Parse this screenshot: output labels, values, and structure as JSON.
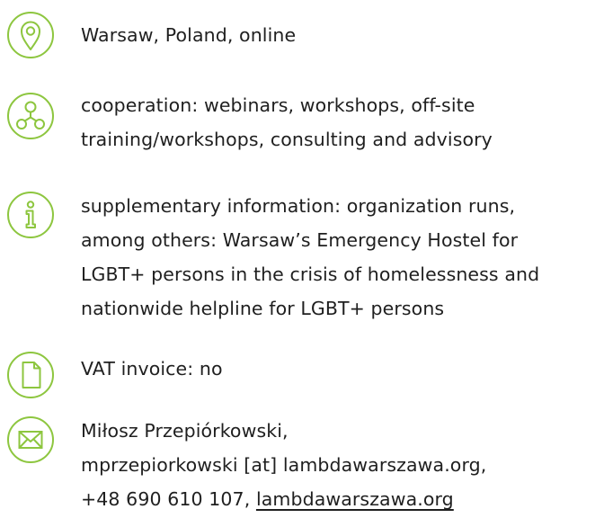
{
  "accent_color": "#8dc63f",
  "text_color": "#1f1f1f",
  "items": [
    {
      "icon": "location-pin-icon",
      "lines": [
        "Warsaw, Poland, online"
      ]
    },
    {
      "icon": "network-nodes-icon",
      "lines": [
        "cooperation: webinars, workshops, off-site",
        "training/workshops, consulting and advisory"
      ]
    },
    {
      "icon": "info-icon",
      "lines": [
        "supplementary information: organization runs,",
        "among others: Warsaw’s Emergency Hostel for",
        "LGBT+ persons in the crisis of homelessness and",
        "nationwide helpline for LGBT+ persons"
      ]
    },
    {
      "icon": "document-icon",
      "lines": [
        "VAT invoice: no"
      ]
    },
    {
      "icon": "envelope-icon",
      "lines": [
        "Miłosz Przepiórkowski,",
        "mprzepiorkowski [at] lambdawarszawa.org,"
      ],
      "phone": "+48 690 610 107, ",
      "website": "lambdawarszawa.org"
    }
  ]
}
